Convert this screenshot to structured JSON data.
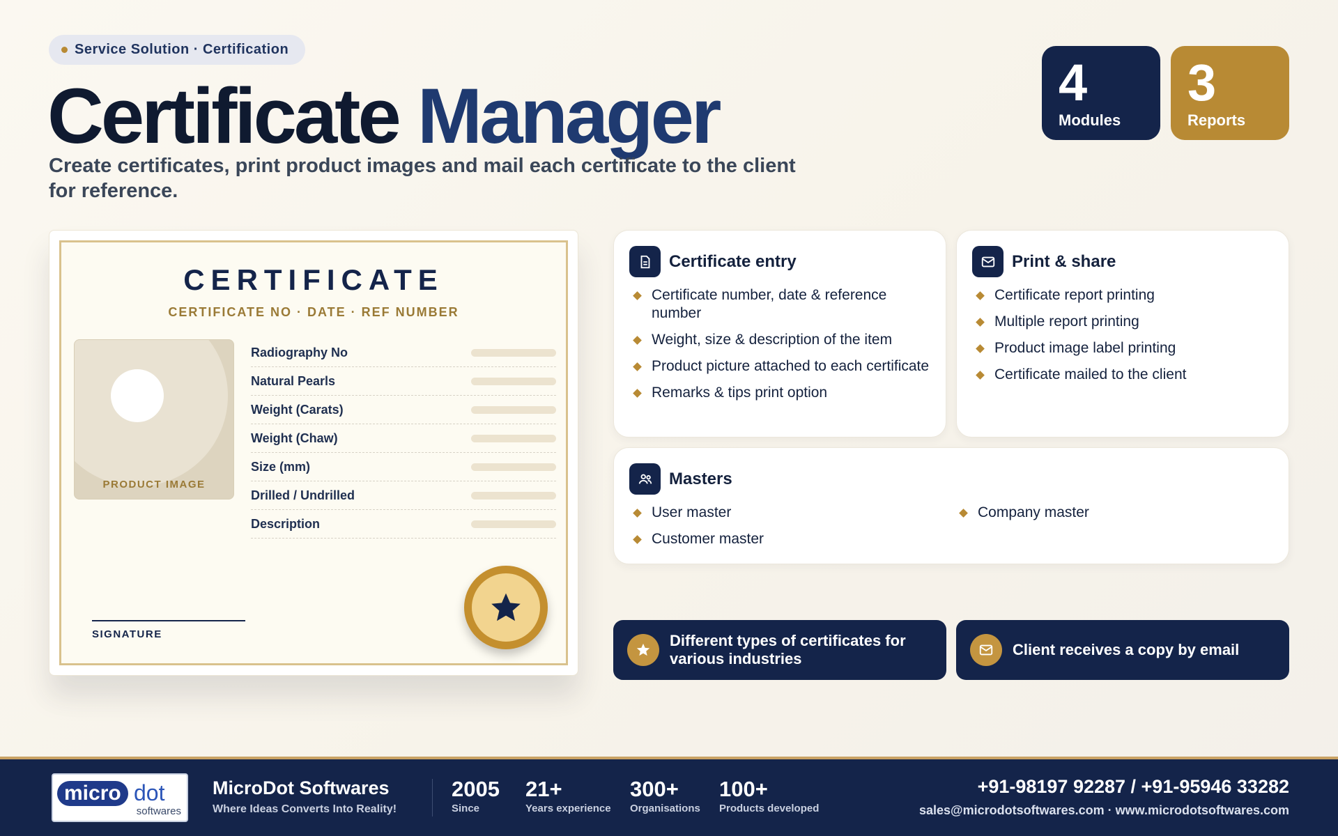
{
  "header": {
    "pill": "Service Solution · Certification",
    "title_part1": "Certificate",
    "title_part2": "Manager",
    "subtitle": "Create certificates, print product images and mail each certificate to the client for reference."
  },
  "stats": {
    "modules": {
      "value": "4",
      "label": "Modules"
    },
    "reports": {
      "value": "3",
      "label": "Reports"
    }
  },
  "certificate": {
    "heading": "CERTIFICATE",
    "subheading": "CERTIFICATE NO · DATE · REF NUMBER",
    "product_image_label": "PRODUCT IMAGE",
    "fields": [
      "Radiography No",
      "Natural Pearls",
      "Weight (Carats)",
      "Weight (Chaw)",
      "Size (mm)",
      "Drilled / Undrilled",
      "Description"
    ],
    "signature_label": "SIGNATURE"
  },
  "cards": {
    "entry": {
      "title": "Certificate entry",
      "items": [
        "Certificate number, date & reference number",
        "Weight, size & description of the item",
        "Product picture attached to each certificate",
        "Remarks & tips print option"
      ]
    },
    "print": {
      "title": "Print & share",
      "items": [
        "Certificate report printing",
        "Multiple report printing",
        "Product image label printing",
        "Certificate mailed to the client"
      ]
    },
    "masters": {
      "title": "Masters",
      "items_left": [
        "User master",
        "Customer master"
      ],
      "items_right": [
        "Company master"
      ]
    }
  },
  "banners": {
    "types": "Different types of certificates for various industries",
    "copy": "Client receives a copy by email"
  },
  "footer": {
    "logo_text_1": "micro",
    "logo_text_2": "dot",
    "logo_text_3": "softwares",
    "brand_name": "MicroDot Softwares",
    "tagline": "Where Ideas Converts Into Reality!",
    "stats": [
      {
        "value": "2005",
        "label": "Since"
      },
      {
        "value": "21+",
        "label": "Years experience"
      },
      {
        "value": "300+",
        "label": "Organisations"
      },
      {
        "value": "100+",
        "label": "Products developed"
      }
    ],
    "phone": "+91-98197 92287 / +91-95946 33282",
    "contact": "sales@microdotsoftwares.com · www.microdotsoftwares.com"
  },
  "colors": {
    "navy": "#14244a",
    "gold": "#b88a34",
    "title_blue": "#1f3a70"
  },
  "icons": {
    "entry": "document-icon",
    "print": "mail-icon",
    "masters": "users-icon",
    "seal": "star-icon",
    "banner_types": "star-icon",
    "banner_copy": "mail-icon"
  }
}
